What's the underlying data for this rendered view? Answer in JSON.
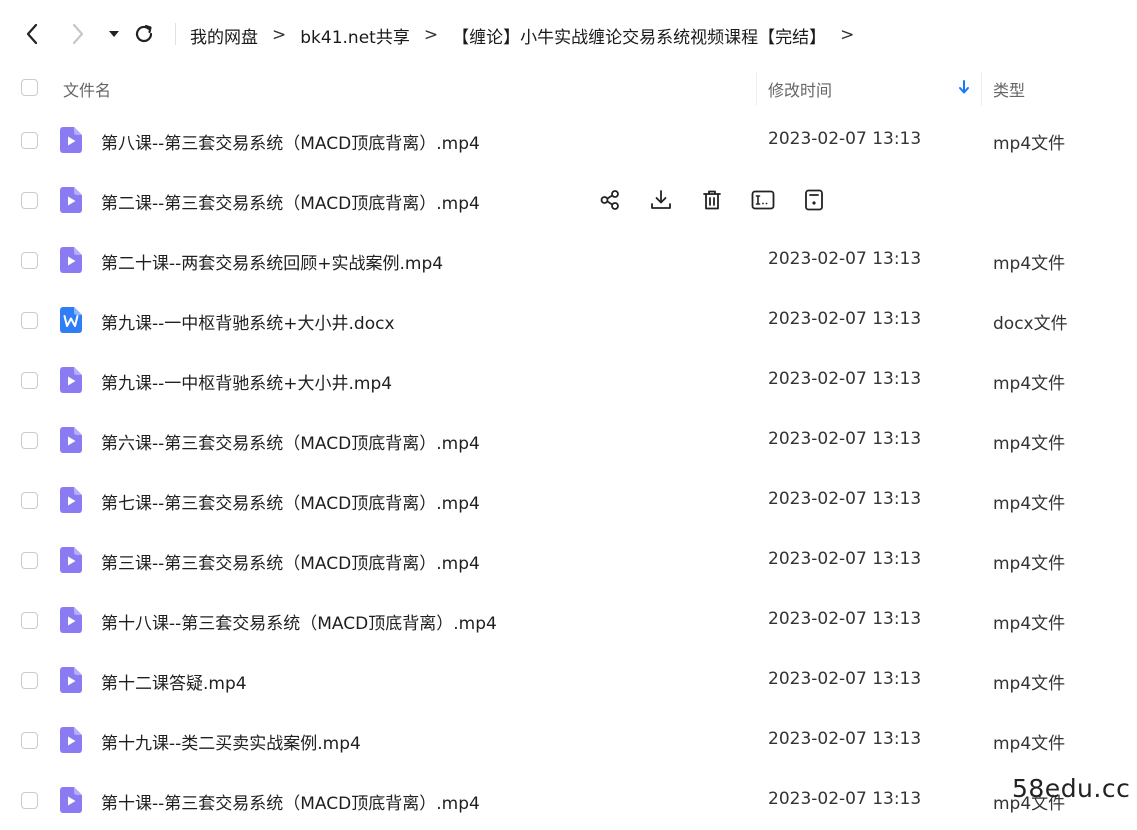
{
  "breadcrumb": {
    "items": [
      "我的网盘",
      "bk41.net共享",
      "【缠论】小牛实战缠论交易系统视频课程【完结】"
    ],
    "separator": ">"
  },
  "columns": {
    "name": "文件名",
    "modified": "修改时间",
    "type": "类型"
  },
  "sort": {
    "column": "修改时间",
    "direction": "descending"
  },
  "files": [
    {
      "name": "第八课--第三套交易系统（MACD顶底背离）.mp4",
      "modified": "2023-02-07 13:13",
      "type": "mp4文件",
      "icon": "video-file-icon"
    },
    {
      "name": "第二课--第三套交易系统（MACD顶底背离）.mp4",
      "modified": "",
      "type": "",
      "icon": "video-file-icon",
      "hovered": true
    },
    {
      "name": "第二十课--两套交易系统回顾+实战案例.mp4",
      "modified": "2023-02-07 13:13",
      "type": "mp4文件",
      "icon": "video-file-icon"
    },
    {
      "name": "第九课--一中枢背驰系统+大小井.docx",
      "modified": "2023-02-07 13:13",
      "type": "docx文件",
      "icon": "word-file-icon"
    },
    {
      "name": "第九课--一中枢背驰系统+大小井.mp4",
      "modified": "2023-02-07 13:13",
      "type": "mp4文件",
      "icon": "video-file-icon"
    },
    {
      "name": "第六课--第三套交易系统（MACD顶底背离）.mp4",
      "modified": "2023-02-07 13:13",
      "type": "mp4文件",
      "icon": "video-file-icon"
    },
    {
      "name": "第七课--第三套交易系统（MACD顶底背离）.mp4",
      "modified": "2023-02-07 13:13",
      "type": "mp4文件",
      "icon": "video-file-icon"
    },
    {
      "name": "第三课--第三套交易系统（MACD顶底背离）.mp4",
      "modified": "2023-02-07 13:13",
      "type": "mp4文件",
      "icon": "video-file-icon"
    },
    {
      "name": "第十八课--第三套交易系统（MACD顶底背离）.mp4",
      "modified": "2023-02-07 13:13",
      "type": "mp4文件",
      "icon": "video-file-icon"
    },
    {
      "name": "第十二课答疑.mp4",
      "modified": "2023-02-07 13:13",
      "type": "mp4文件",
      "icon": "video-file-icon"
    },
    {
      "name": "第十九课--类二买卖实战案例.mp4",
      "modified": "2023-02-07 13:13",
      "type": "mp4文件",
      "icon": "video-file-icon"
    },
    {
      "name": "第十课--第三套交易系统（MACD顶底背离）.mp4",
      "modified": "2023-02-07 13:13",
      "type": "mp4文件",
      "icon": "video-file-icon"
    }
  ],
  "row_actions": [
    "share-icon",
    "download-icon",
    "delete-icon",
    "rename-icon",
    "more-info-icon"
  ],
  "colors": {
    "video_icon": "#8b7bf2",
    "word_icon": "#2f7ef5",
    "sort_arrow": "#1677ff",
    "checkbox_border": "#c9cbd1"
  },
  "watermark": "58edu.cc"
}
